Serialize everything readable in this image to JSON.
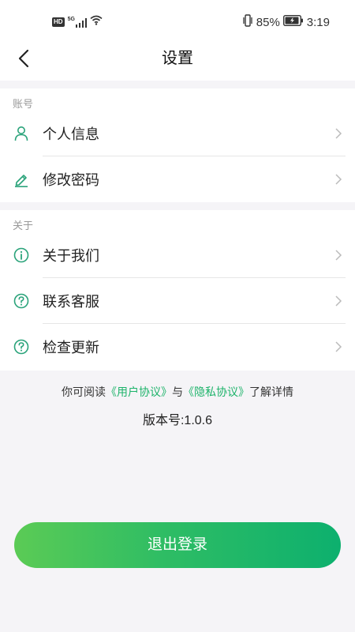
{
  "status_bar": {
    "network_badge": "HD",
    "network_type": "5G",
    "battery_percent": "85%",
    "time": "3:19"
  },
  "header": {
    "title": "设置"
  },
  "account_section": {
    "title": "账号",
    "items": [
      {
        "label": "个人信息",
        "icon": "person-icon"
      },
      {
        "label": "修改密码",
        "icon": "edit-pencil-icon"
      }
    ]
  },
  "about_section": {
    "title": "关于",
    "items": [
      {
        "label": "关于我们",
        "icon": "info-icon"
      },
      {
        "label": "联系客服",
        "icon": "question-icon"
      },
      {
        "label": "检查更新",
        "icon": "question-icon"
      }
    ]
  },
  "agreement": {
    "prefix": "你可阅读",
    "user_agreement": "《用户协议》",
    "connector": "与",
    "privacy_agreement": "《隐私协议》",
    "suffix": "了解详情"
  },
  "version": {
    "text": "版本号:1.0.6"
  },
  "logout": {
    "label": "退出登录"
  },
  "colors": {
    "accent": "#1db36a",
    "icon_green": "#2aa37a",
    "button_gradient_start": "#5bcb55",
    "button_gradient_end": "#0db06e",
    "background": "#f5f4f7"
  }
}
